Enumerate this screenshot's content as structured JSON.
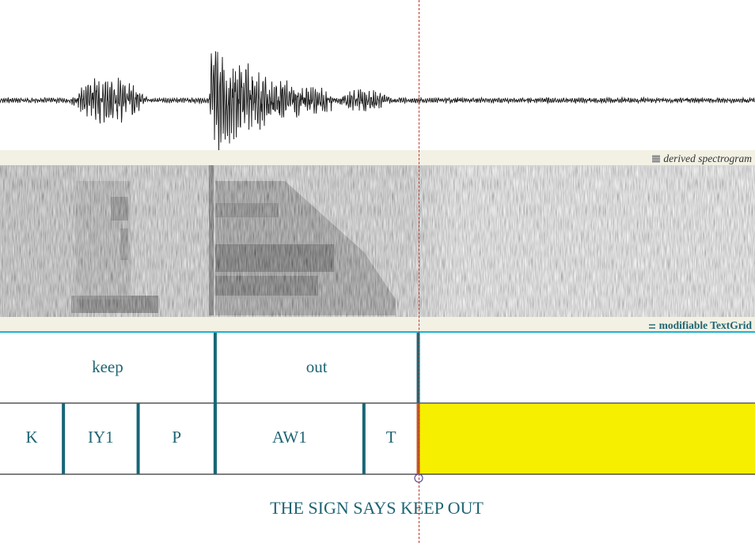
{
  "panels": {
    "spectrogram_label": "derived spectrogram",
    "textgrid_label": "modifiable TextGrid"
  },
  "tiers": {
    "words": [
      {
        "label": "keep",
        "start": 0.0,
        "end": 0.285
      },
      {
        "label": "out",
        "start": 0.285,
        "end": 0.554
      },
      {
        "label": "",
        "start": 0.554,
        "end": 1.0
      }
    ],
    "phones": [
      {
        "label": "K",
        "start": 0.0,
        "end": 0.084
      },
      {
        "label": "IY1",
        "start": 0.084,
        "end": 0.183
      },
      {
        "label": "P",
        "start": 0.183,
        "end": 0.285
      },
      {
        "label": "AW1",
        "start": 0.285,
        "end": 0.482
      },
      {
        "label": "T",
        "start": 0.482,
        "end": 0.554
      },
      {
        "label": "",
        "start": 0.554,
        "end": 1.0,
        "selected": true
      }
    ],
    "sentence": "THE SIGN SAYS KEEP OUT"
  },
  "cursor": {
    "position": 0.554
  },
  "colors": {
    "boundary": "#176677",
    "label": "#1f6573",
    "selection": "#f7ef00",
    "band": "#f2f1e4",
    "accent_line": "#19b3d6",
    "cursor": "#c0392b"
  }
}
